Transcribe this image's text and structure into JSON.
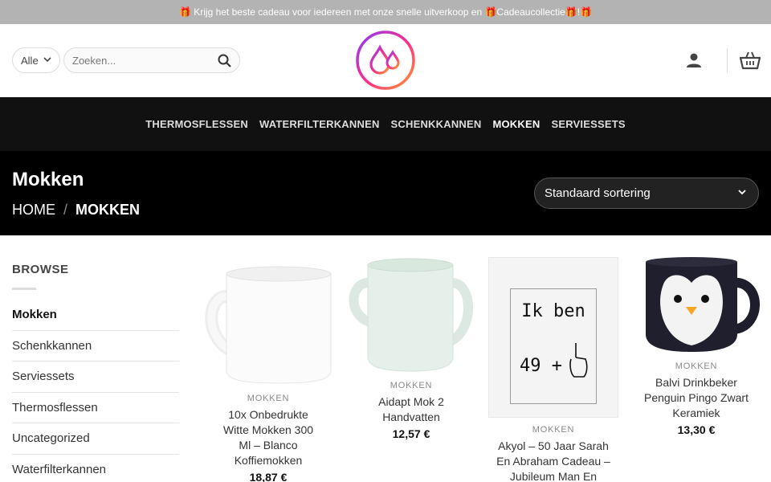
{
  "topbar": {
    "text": "🎁 Krijg het beste cadeau voor iedereen met onze snelle uitverkoop en 🎁Cadeaucollectie🎁!🎁"
  },
  "search": {
    "category": "Alle",
    "placeholder": "Zoeken..."
  },
  "nav": {
    "items": [
      {
        "label": "THERMOSFLESSEN",
        "active": false
      },
      {
        "label": "WATERFILTERKANNEN",
        "active": false
      },
      {
        "label": "SCHENKKANNEN",
        "active": false
      },
      {
        "label": "MOKKEN",
        "active": true
      },
      {
        "label": "SERVIESSETS",
        "active": false
      }
    ]
  },
  "page": {
    "title": "Mokken",
    "breadcrumb_home": "HOME",
    "breadcrumb_sep": "/",
    "breadcrumb_current": "MOKKEN",
    "sort_label": "Standaard sortering"
  },
  "sidebar": {
    "heading": "BROWSE",
    "items": [
      "Mokken",
      "Schenkkannen",
      "Serviessets",
      "Thermosflessen",
      "Uncategorized",
      "Waterfilterkannen"
    ]
  },
  "products": [
    {
      "category": "MOKKEN",
      "title": "10x Onbedrukte Witte Mokken 300 Ml – Blanco Koffiemokken",
      "price": "18,87 €"
    },
    {
      "category": "MOKKEN",
      "title": "Aidapt Mok 2 Handvatten",
      "price": "12,57 €"
    },
    {
      "category": "MOKKEN",
      "title": "Akyol – 50 Jaar Sarah En Abraham Cadeau – Jubileum Man En",
      "price": "",
      "image_text": [
        "Ik ben",
        "49 +"
      ]
    },
    {
      "category": "MOKKEN",
      "title": "Balvi Drinkbeker Penguin Pingo Zwart Keramiek",
      "price": "13,30 €"
    }
  ],
  "colors": {
    "nav_bg": "#111111",
    "titlebar_bg": "#000000",
    "topbar_bg": "#b3b3b3",
    "logo_gradient": [
      "#8b3cf7",
      "#ff2e86",
      "#ff9b2e"
    ]
  }
}
